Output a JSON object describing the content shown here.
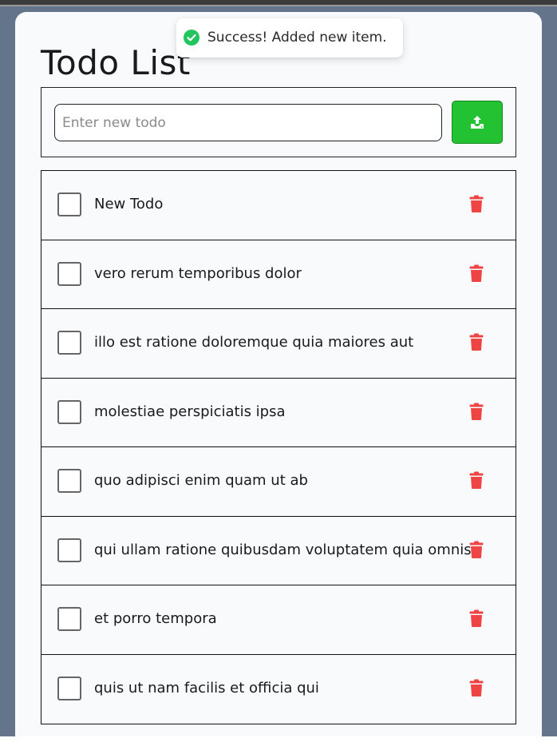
{
  "page": {
    "title": "Todo List"
  },
  "toast": {
    "message": "Success! Added new item.",
    "icon": "check-circle-icon",
    "icon_color": "#22c55e"
  },
  "new_todo": {
    "placeholder": "Enter new todo",
    "value": "",
    "submit_icon": "upload-icon",
    "button_color": "#22c232"
  },
  "todos": [
    {
      "text": "New Todo",
      "done": false
    },
    {
      "text": "vero rerum temporibus dolor",
      "done": false
    },
    {
      "text": "illo est ratione doloremque quia maiores aut",
      "done": false
    },
    {
      "text": "molestiae perspiciatis ipsa",
      "done": false
    },
    {
      "text": "quo adipisci enim quam ut ab",
      "done": false
    },
    {
      "text": "qui ullam ratione quibusdam voluptatem quia omnis",
      "done": false
    },
    {
      "text": "et porro tempora",
      "done": false
    },
    {
      "text": "quis ut nam facilis et officia qui",
      "done": false
    }
  ],
  "delete_icon": "trash-icon",
  "delete_color": "#ef4444"
}
